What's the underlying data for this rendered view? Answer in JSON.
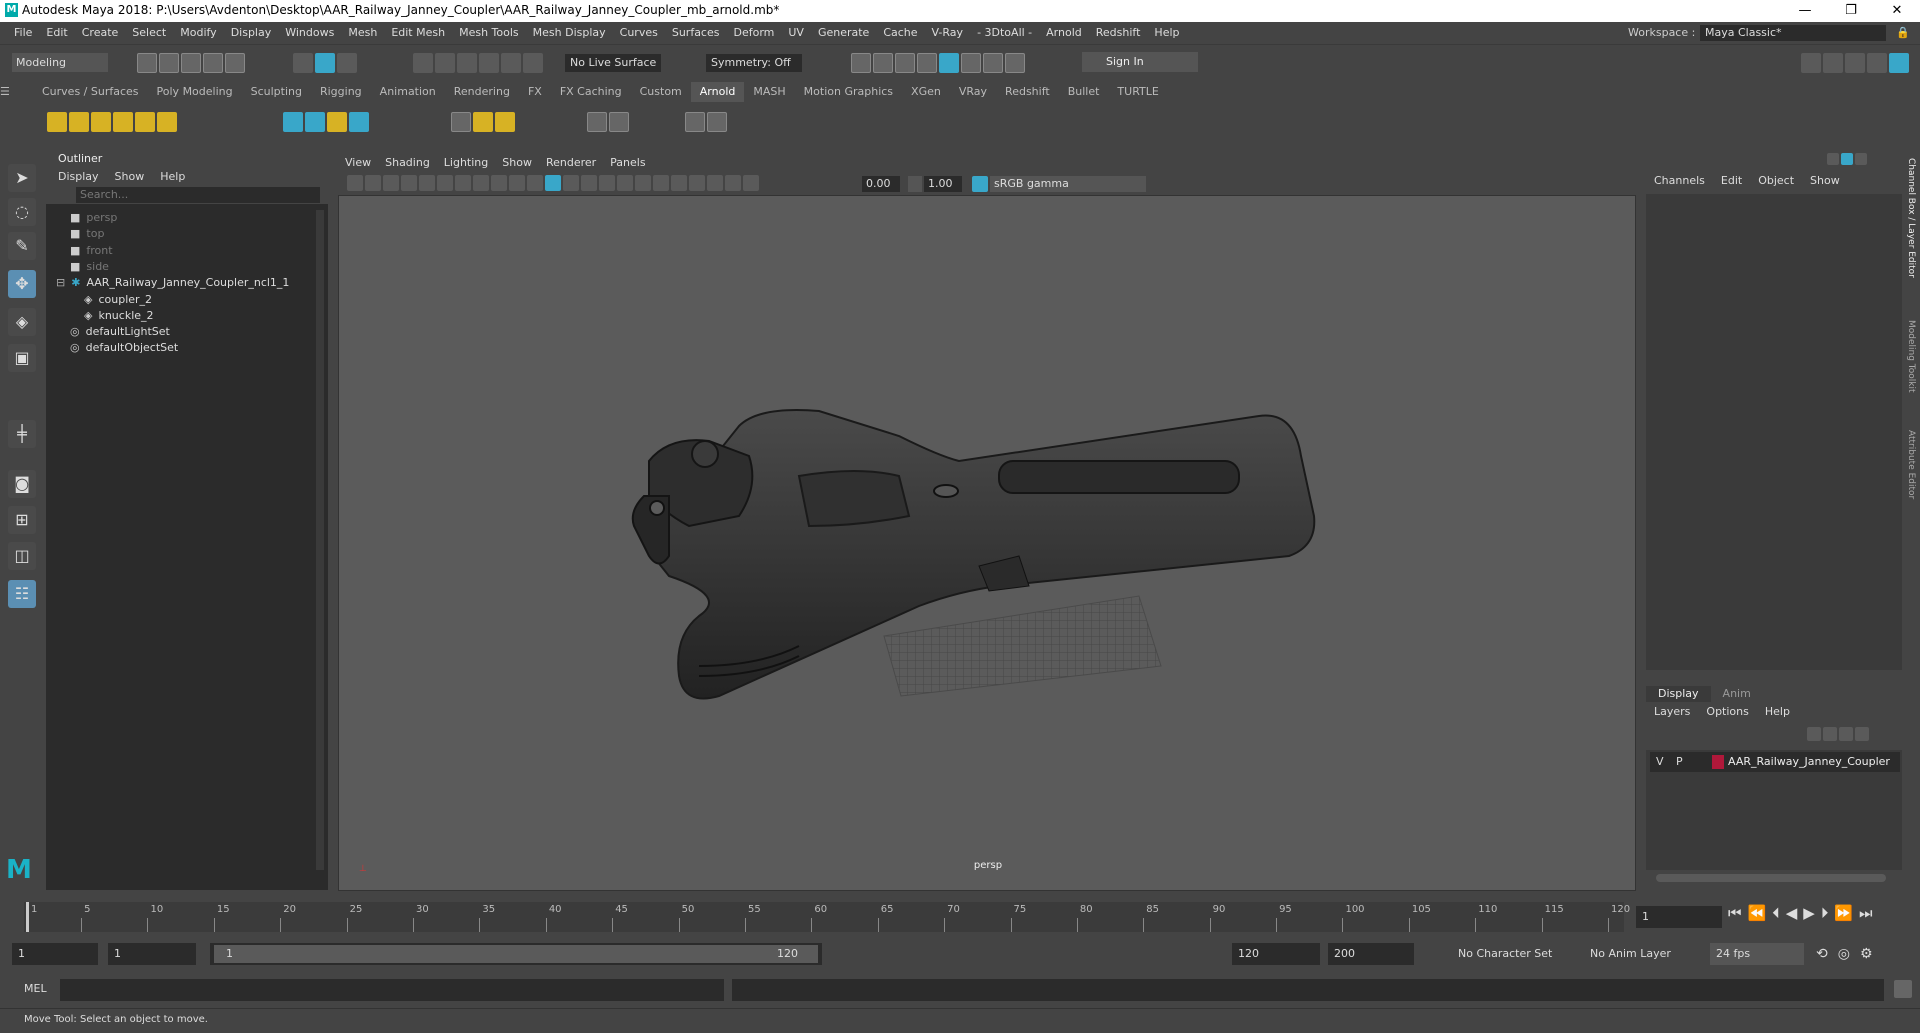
{
  "title": "Autodesk Maya 2018: P:\\Users\\Avdenton\\Desktop\\AAR_Railway_Janney_Coupler\\AAR_Railway_Janney_Coupler_mb_arnold.mb*",
  "menus": [
    "File",
    "Edit",
    "Create",
    "Select",
    "Modify",
    "Display",
    "Windows",
    "Mesh",
    "Edit Mesh",
    "Mesh Tools",
    "Mesh Display",
    "Curves",
    "Surfaces",
    "Deform",
    "UV",
    "Generate",
    "Cache",
    "V-Ray",
    "- 3DtoAll -",
    "Arnold",
    "Redshift",
    "Help"
  ],
  "workspace": {
    "label": "Workspace :",
    "value": "Maya Classic*"
  },
  "status": {
    "mode": "Modeling",
    "live_surface": "No Live Surface",
    "symmetry": "Symmetry: Off",
    "sign_in": "Sign In"
  },
  "shelf_tabs": [
    "Curves / Surfaces",
    "Poly Modeling",
    "Sculpting",
    "Rigging",
    "Animation",
    "Rendering",
    "FX",
    "FX Caching",
    "Custom",
    "Arnold",
    "MASH",
    "Motion Graphics",
    "XGen",
    "VRay",
    "Redshift",
    "Bullet",
    "TURTLE"
  ],
  "active_shelf": "Arnold",
  "outliner": {
    "title": "Outliner",
    "menus": [
      "Display",
      "Show",
      "Help"
    ],
    "search_placeholder": "Search...",
    "items": [
      {
        "label": "persp",
        "icon": "camera-icon",
        "dim": true
      },
      {
        "label": "top",
        "icon": "camera-icon",
        "dim": true
      },
      {
        "label": "front",
        "icon": "camera-icon",
        "dim": true
      },
      {
        "label": "side",
        "icon": "camera-icon",
        "dim": true
      },
      {
        "label": "AAR_Railway_Janney_Coupler_ncl1_1",
        "icon": "group-icon",
        "dim": false
      },
      {
        "label": "coupler_2",
        "icon": "mesh-icon",
        "dim": false
      },
      {
        "label": "knuckle_2",
        "icon": "mesh-icon",
        "dim": false
      },
      {
        "label": "defaultLightSet",
        "icon": "set-icon",
        "dim": false
      },
      {
        "label": "defaultObjectSet",
        "icon": "set-icon",
        "dim": false
      }
    ]
  },
  "viewport": {
    "menus": [
      "View",
      "Shading",
      "Lighting",
      "Show",
      "Renderer",
      "Panels"
    ],
    "exposure": "0.00",
    "gamma": "1.00",
    "color_space": "sRGB gamma",
    "camera_label": "persp"
  },
  "channel_box": {
    "menus": [
      "Channels",
      "Edit",
      "Object",
      "Show"
    ]
  },
  "layer_editor": {
    "tabs": [
      "Display",
      "Anim"
    ],
    "menus": [
      "Layers",
      "Options",
      "Help"
    ],
    "layer": {
      "v": "V",
      "p": "P",
      "name": "AAR_Railway_Janney_Coupler",
      "color": "#b0183a"
    }
  },
  "side_tabs": [
    "Channel Box / Layer Editor",
    "Modeling Toolkit",
    "Attribute Editor"
  ],
  "timeline": {
    "ticks": [
      "1",
      "5",
      "10",
      "15",
      "20",
      "25",
      "30",
      "35",
      "40",
      "45",
      "50",
      "55",
      "60",
      "65",
      "70",
      "75",
      "80",
      "85",
      "90",
      "95",
      "100",
      "105",
      "110",
      "115",
      "120"
    ],
    "current_frame": "1"
  },
  "range": {
    "start": "1",
    "playback_start": "1",
    "slider_start": "1",
    "slider_end": "120",
    "playback_end": "120",
    "end": "200",
    "character_set": "No Character Set",
    "anim_layer": "No Anim Layer",
    "fps": "24 fps"
  },
  "mel": {
    "label": "MEL"
  },
  "help_line": "Move Tool: Select an object to move."
}
